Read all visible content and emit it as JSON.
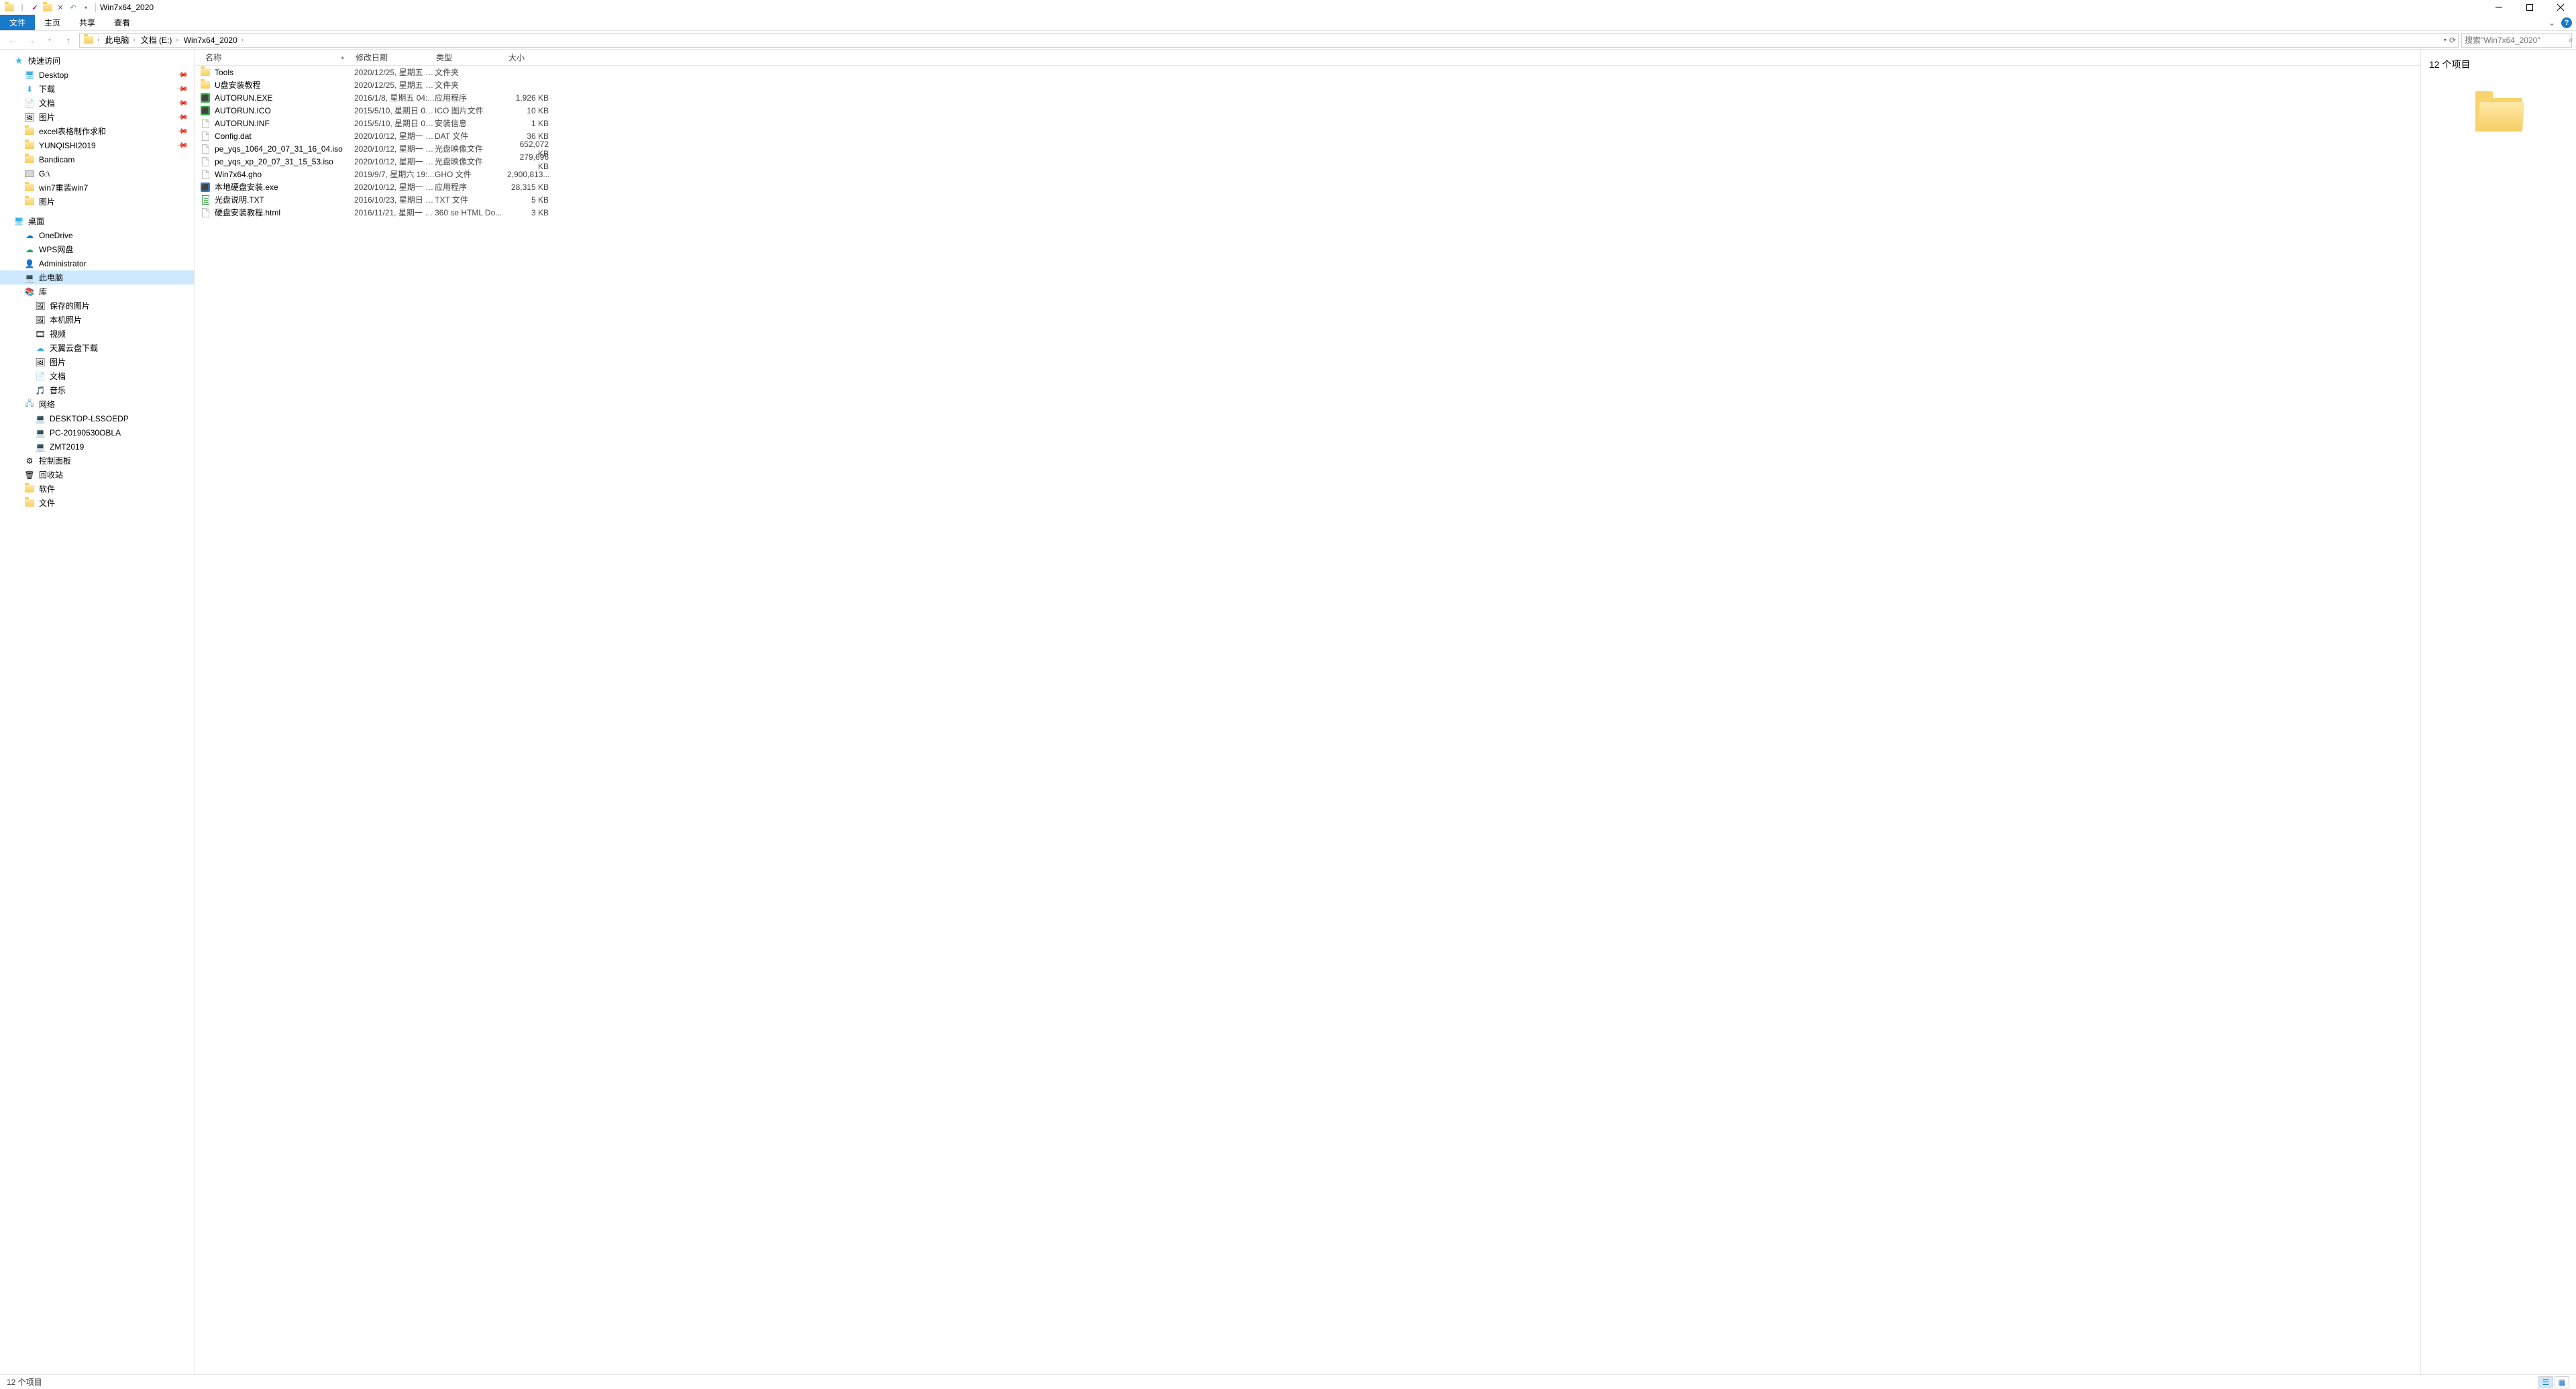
{
  "window": {
    "title": "Win7x64_2020"
  },
  "ribbon": {
    "file": "文件",
    "home": "主页",
    "share": "共享",
    "view": "查看"
  },
  "breadcrumb": {
    "root": "此电脑",
    "drive": "文档 (E:)",
    "folder": "Win7x64_2020"
  },
  "search": {
    "placeholder": "搜索\"Win7x64_2020\""
  },
  "columns": {
    "name": "名称",
    "date": "修改日期",
    "type": "类型",
    "size": "大小"
  },
  "tree": {
    "quickaccess": "快速访问",
    "desktop": "Desktop",
    "downloads": "下载",
    "documents": "文档",
    "pictures": "图片",
    "excel": "excel表格制作求和",
    "yunqishi": "YUNQISHI2019",
    "bandicam": "Bandicam",
    "gdrive": "G:\\",
    "win7reinstall": "win7重装win7",
    "pictures2": "图片",
    "desktop_cn": "桌面",
    "onedrive": "OneDrive",
    "wps": "WPS网盘",
    "admin": "Administrator",
    "thispc": "此电脑",
    "libraries": "库",
    "savedpics": "保存的图片",
    "localpics": "本机照片",
    "video": "视频",
    "tianyi": "天翼云盘下载",
    "libpics": "图片",
    "libdocs": "文档",
    "libmusic": "音乐",
    "network": "网络",
    "pc1": "DESKTOP-LSSOEDP",
    "pc2": "PC-20190530OBLA",
    "pc3": "ZMT2019",
    "controlpanel": "控制面板",
    "recycle": "回收站",
    "software": "软件",
    "files": "文件"
  },
  "files": [
    {
      "icon": "folder",
      "name": "Tools",
      "date": "2020/12/25, 星期五 1...",
      "type": "文件夹",
      "size": ""
    },
    {
      "icon": "folder",
      "name": "U盘安装教程",
      "date": "2020/12/25, 星期五 1...",
      "type": "文件夹",
      "size": ""
    },
    {
      "icon": "exe-green",
      "name": "AUTORUN.EXE",
      "date": "2016/1/8, 星期五 04:...",
      "type": "应用程序",
      "size": "1,926 KB"
    },
    {
      "icon": "exe-green",
      "name": "AUTORUN.ICO",
      "date": "2015/5/10, 星期日 02...",
      "type": "ICO 图片文件",
      "size": "10 KB"
    },
    {
      "icon": "file",
      "name": "AUTORUN.INF",
      "date": "2015/5/10, 星期日 02...",
      "type": "安装信息",
      "size": "1 KB"
    },
    {
      "icon": "file",
      "name": "Config.dat",
      "date": "2020/10/12, 星期一 1...",
      "type": "DAT 文件",
      "size": "36 KB"
    },
    {
      "icon": "file",
      "name": "pe_yqs_1064_20_07_31_16_04.iso",
      "date": "2020/10/12, 星期一 1...",
      "type": "光盘映像文件",
      "size": "652,072 KB"
    },
    {
      "icon": "file",
      "name": "pe_yqs_xp_20_07_31_15_53.iso",
      "date": "2020/10/12, 星期一 1...",
      "type": "光盘映像文件",
      "size": "279,696 KB"
    },
    {
      "icon": "file",
      "name": "Win7x64.gho",
      "date": "2019/9/7, 星期六 19:...",
      "type": "GHO 文件",
      "size": "2,900,813..."
    },
    {
      "icon": "exe-blue",
      "name": "本地硬盘安装.exe",
      "date": "2020/10/12, 星期一 1...",
      "type": "应用程序",
      "size": "28,315 KB"
    },
    {
      "icon": "txt-green",
      "name": "光盘说明.TXT",
      "date": "2016/10/23, 星期日 0...",
      "type": "TXT 文件",
      "size": "5 KB"
    },
    {
      "icon": "file",
      "name": "硬盘安装教程.html",
      "date": "2016/11/21, 星期一 2...",
      "type": "360 se HTML Do...",
      "size": "3 KB"
    }
  ],
  "preview": {
    "count_label": "12 个项目"
  },
  "status": {
    "text": "12 个项目"
  }
}
